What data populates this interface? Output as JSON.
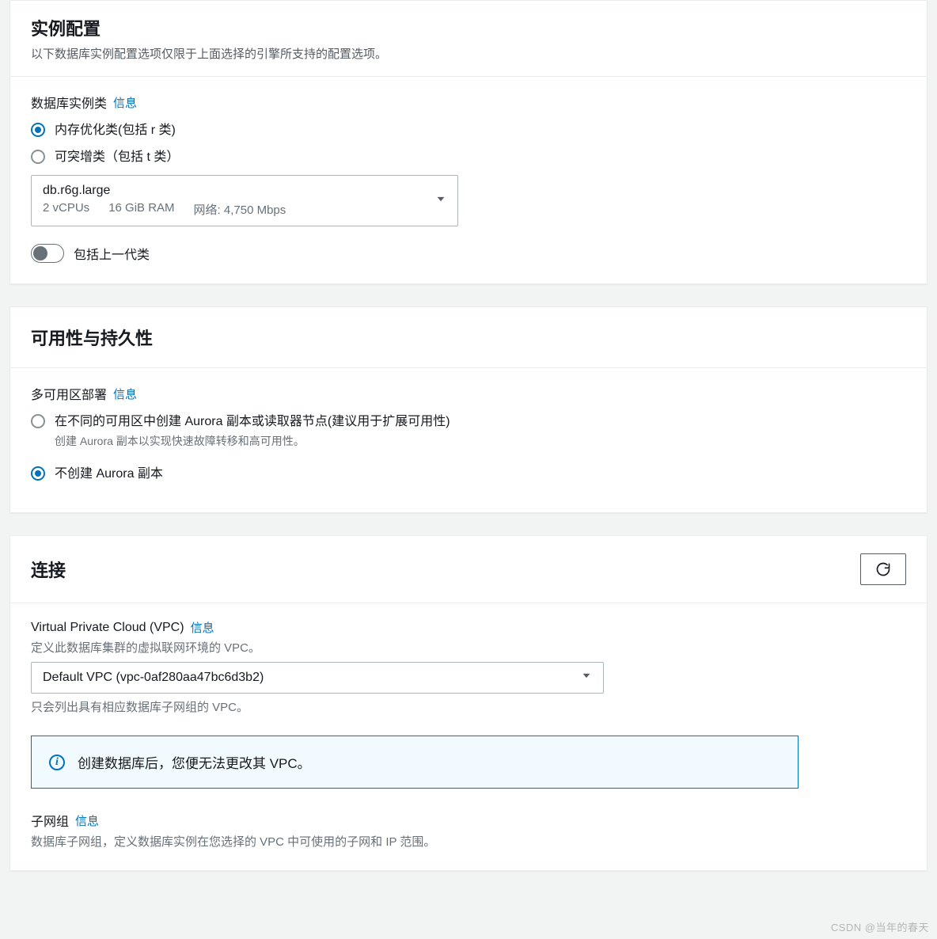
{
  "instanceConfig": {
    "title": "实例配置",
    "subtitle": "以下数据库实例配置选项仅限于上面选择的引擎所支持的配置选项。",
    "classLabel": "数据库实例类",
    "infoLink": "信息",
    "radios": {
      "memory": "内存优化类(包括 r 类)",
      "burstable": "可突增类（包括 t 类）"
    },
    "instance": {
      "name": "db.r6g.large",
      "vcpu": "2 vCPUs",
      "ram": "16 GiB RAM",
      "network": "网络: 4,750 Mbps"
    },
    "toggleLabel": "包括上一代类"
  },
  "availability": {
    "title": "可用性与持久性",
    "label": "多可用区部署",
    "infoLink": "信息",
    "option1": "在不同的可用区中创建 Aurora 副本或读取器节点(建议用于扩展可用性)",
    "option1desc": "创建 Aurora 副本以实现快速故障转移和高可用性。",
    "option2": "不创建 Aurora 副本"
  },
  "connection": {
    "title": "连接",
    "vpcLabel": "Virtual Private Cloud (VPC)",
    "infoLink": "信息",
    "vpcDesc": "定义此数据库集群的虚拟联网环境的 VPC。",
    "vpcValue": "Default VPC (vpc-0af280aa47bc6d3b2)",
    "vpcHint": "只会列出具有相应数据库子网组的 VPC。",
    "noticeText": "创建数据库后，您便无法更改其 VPC。",
    "subnetLabel": "子网组",
    "subnetDesc": "数据库子网组，定义数据库实例在您选择的 VPC 中可使用的子网和 IP 范围。"
  },
  "watermark": "CSDN @当年的春天"
}
